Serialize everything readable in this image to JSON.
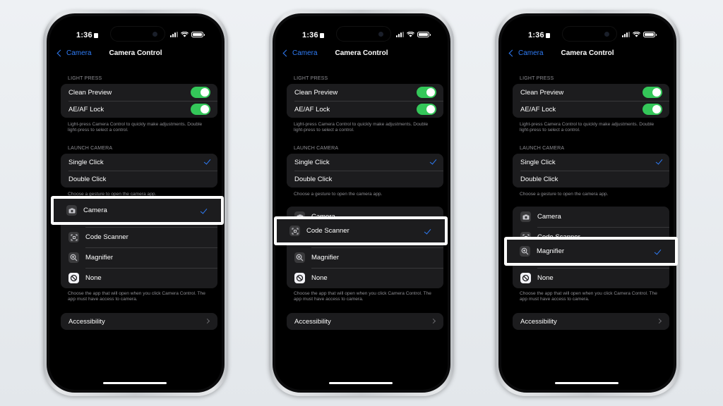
{
  "colors": {
    "accent": "#2f7cf6",
    "toggle_on": "#34c759",
    "group_bg": "#1c1c1e",
    "highlight_border": "#ffffff"
  },
  "phones": [
    {
      "status": {
        "time": "1:36"
      },
      "nav": {
        "back_label": "Camera",
        "title": "Camera Control"
      },
      "light_press": {
        "header": "LIGHT PRESS",
        "rows": [
          {
            "label": "Clean Preview",
            "on": true
          },
          {
            "label": "AE/AF Lock",
            "on": true
          }
        ],
        "footer": "Light-press Camera Control to quickly make adjustments. Double light-press to select a control."
      },
      "launch_camera": {
        "header": "LAUNCH CAMERA",
        "rows": [
          {
            "label": "Single Click",
            "checked": true
          },
          {
            "label": "Double Click",
            "checked": false
          }
        ],
        "footer": "Choose a gesture to open the camera app."
      },
      "apps": {
        "rows": [
          {
            "label": "Camera",
            "icon": "camera-icon",
            "selected": true
          },
          {
            "label": "Code Scanner",
            "icon": "code-scanner-icon",
            "selected": false
          },
          {
            "label": "Magnifier",
            "icon": "magnifier-icon",
            "selected": false
          },
          {
            "label": "None",
            "icon": "none-icon",
            "selected": false
          }
        ],
        "footer": "Choose the app that will open when you click Camera Control. The app must have access to camera."
      },
      "accessibility": {
        "label": "Accessibility"
      }
    },
    {
      "status": {
        "time": "1:36"
      },
      "nav": {
        "back_label": "Camera",
        "title": "Camera Control"
      },
      "light_press": {
        "header": "LIGHT PRESS",
        "rows": [
          {
            "label": "Clean Preview",
            "on": true
          },
          {
            "label": "AE/AF Lock",
            "on": true
          }
        ],
        "footer": "Light-press Camera Control to quickly make adjustments. Double light-press to select a control."
      },
      "launch_camera": {
        "header": "LAUNCH CAMERA",
        "rows": [
          {
            "label": "Single Click",
            "checked": true
          },
          {
            "label": "Double Click",
            "checked": false
          }
        ],
        "footer": "Choose a gesture to open the camera app."
      },
      "apps": {
        "rows": [
          {
            "label": "Camera",
            "icon": "camera-icon",
            "selected": false
          },
          {
            "label": "Code Scanner",
            "icon": "code-scanner-icon",
            "selected": true
          },
          {
            "label": "Magnifier",
            "icon": "magnifier-icon",
            "selected": false
          },
          {
            "label": "None",
            "icon": "none-icon",
            "selected": false
          }
        ],
        "footer": "Choose the app that will open when you click Camera Control. The app must have access to camera."
      },
      "accessibility": {
        "label": "Accessibility"
      }
    },
    {
      "status": {
        "time": "1:36"
      },
      "nav": {
        "back_label": "Camera",
        "title": "Camera Control"
      },
      "light_press": {
        "header": "LIGHT PRESS",
        "rows": [
          {
            "label": "Clean Preview",
            "on": true
          },
          {
            "label": "AE/AF Lock",
            "on": true
          }
        ],
        "footer": "Light-press Camera Control to quickly make adjustments. Double light-press to select a control."
      },
      "launch_camera": {
        "header": "LAUNCH CAMERA",
        "rows": [
          {
            "label": "Single Click",
            "checked": true
          },
          {
            "label": "Double Click",
            "checked": false
          }
        ],
        "footer": "Choose a gesture to open the camera app."
      },
      "apps": {
        "rows": [
          {
            "label": "Camera",
            "icon": "camera-icon",
            "selected": false
          },
          {
            "label": "Code Scanner",
            "icon": "code-scanner-icon",
            "selected": false
          },
          {
            "label": "Magnifier",
            "icon": "magnifier-icon",
            "selected": true
          },
          {
            "label": "None",
            "icon": "none-icon",
            "selected": false
          }
        ],
        "footer": "Choose the app that will open when you click Camera Control. The app must have access to camera."
      },
      "accessibility": {
        "label": "Accessibility"
      }
    }
  ]
}
